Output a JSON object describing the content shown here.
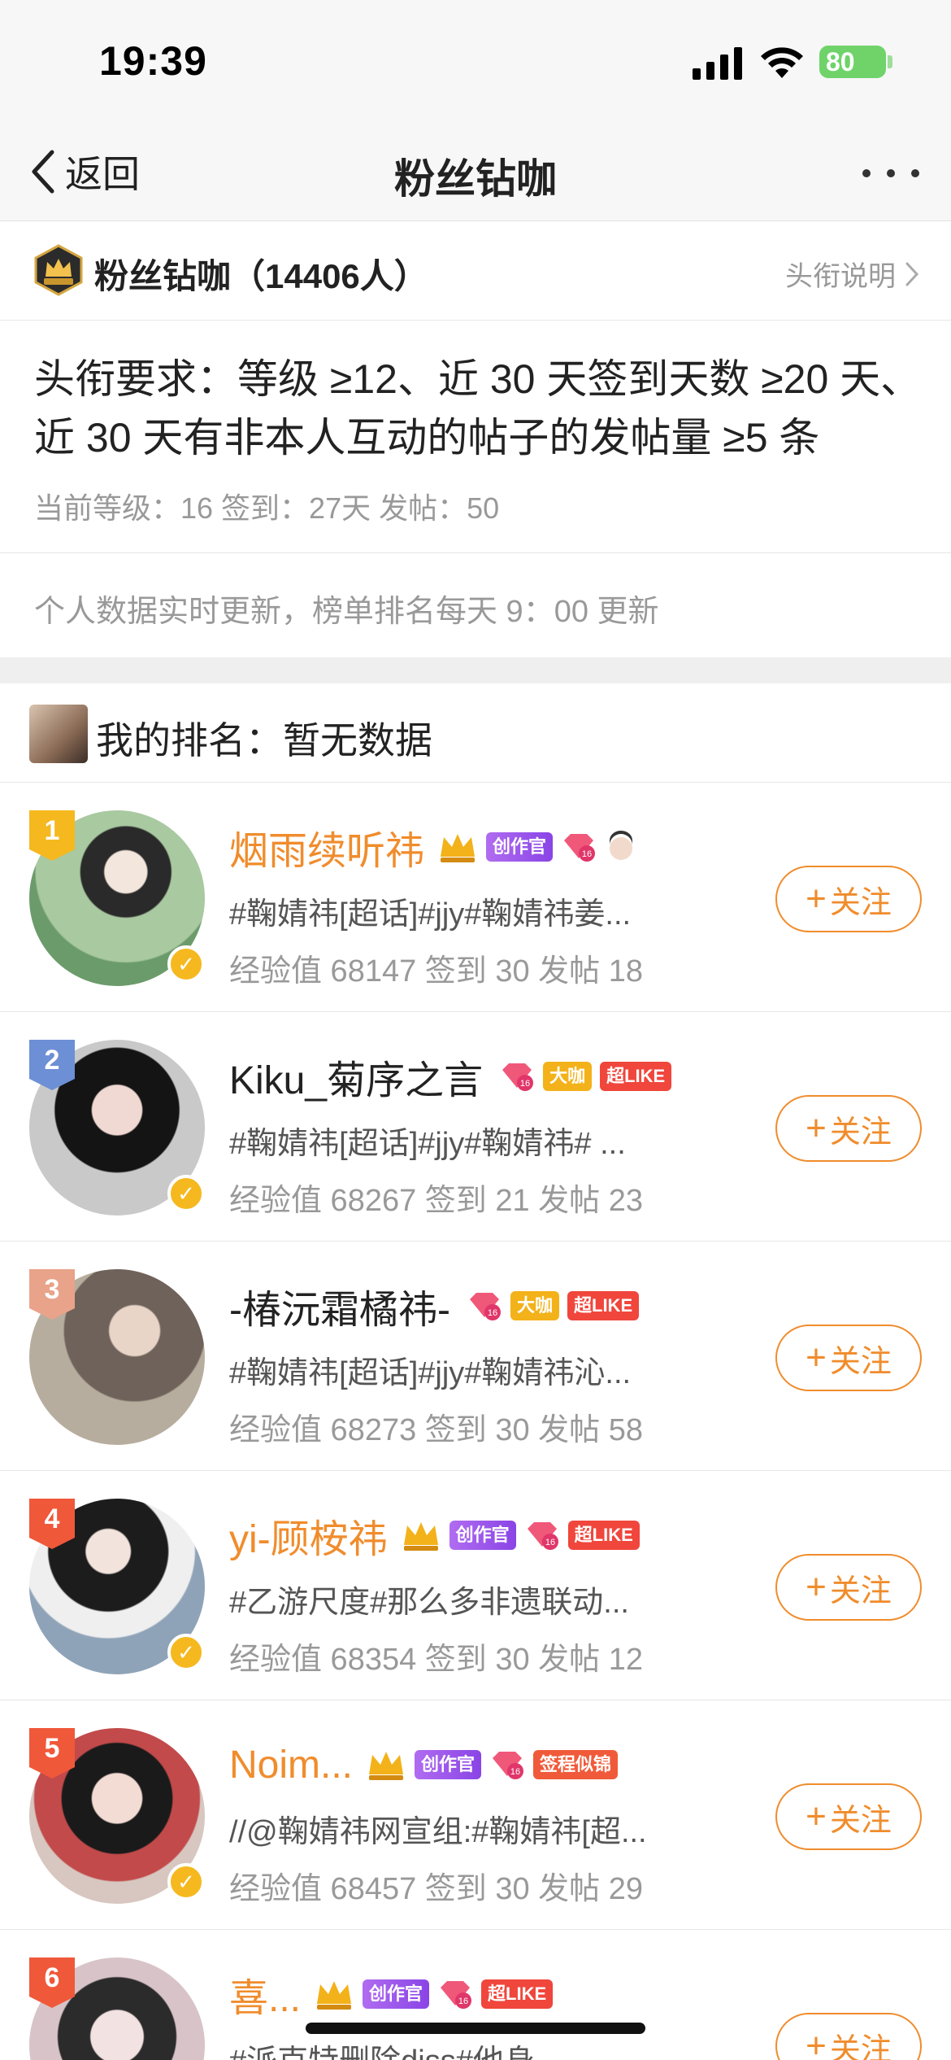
{
  "status_bar": {
    "time": "19:39",
    "battery": "80"
  },
  "nav": {
    "back_label": "返回",
    "title": "粉丝钻咖"
  },
  "header": {
    "label": "粉丝钻咖（14406人）",
    "explain": "头衔说明"
  },
  "requirement": {
    "text": "头衔要求：等级 ≥12、近 30 天签到天数 ≥20 天、近 30 天有非本人互动的帖子的发帖量 ≥5 条",
    "current": "当前等级：16 签到：27天 发帖：50"
  },
  "note": "个人数据实时更新，榜单排名每天 9：00 更新",
  "my_rank": "我的排名：暂无数据",
  "follow_label": "关注",
  "colors": {
    "accent": "#f08c2c",
    "rank1": "#f5b81f",
    "rank2": "#6d8fd6",
    "rank3": "#e8a38a",
    "rank_other": "#f0583a"
  },
  "users": [
    {
      "rank": "1",
      "name": "烟雨续听祎",
      "gold": true,
      "tags": [
        "crown",
        "创作官",
        "gem",
        "face"
      ],
      "desc": "#鞠婧祎[超话]#jjy#鞠婧祎姜...",
      "stats": "经验值 68147 签到 30 发帖 18",
      "verified": true
    },
    {
      "rank": "2",
      "name": "Kiku_菊序之言",
      "gold": false,
      "tags": [
        "gem",
        "大咖",
        "超LIKE"
      ],
      "desc": "#鞠婧祎[超话]#jjy#鞠婧祎# ...",
      "stats": "经验值 68267 签到 21 发帖 23",
      "verified": true
    },
    {
      "rank": "3",
      "name": "-椿沅霜橘祎-",
      "gold": false,
      "tags": [
        "gem",
        "大咖",
        "超LIKE"
      ],
      "desc": "#鞠婧祎[超话]#jjy#鞠婧祎沁...",
      "stats": "经验值 68273 签到 30 发帖 58",
      "verified": false
    },
    {
      "rank": "4",
      "name": "yi-顾桉祎",
      "gold": true,
      "tags": [
        "crown",
        "创作官",
        "gem",
        "超LIKE"
      ],
      "desc": "#乙游尺度#那么多非遗联动...",
      "stats": "经验值 68354 签到 30 发帖 12",
      "verified": true
    },
    {
      "rank": "5",
      "name": "Noim...",
      "gold": true,
      "tags": [
        "crown",
        "创作官",
        "gem",
        "签程似锦"
      ],
      "desc": "//@鞠婧祎网宣组:#鞠婧祎[超...",
      "stats": "经验值 68457 签到 30 发帖 29",
      "verified": true
    },
    {
      "rank": "6",
      "name": "喜...",
      "gold": true,
      "tags": [
        "crown",
        "创作官",
        "gem",
        "超LIKE"
      ],
      "desc": "#派克特删除diss#他身...",
      "stats": "",
      "verified": false
    }
  ]
}
